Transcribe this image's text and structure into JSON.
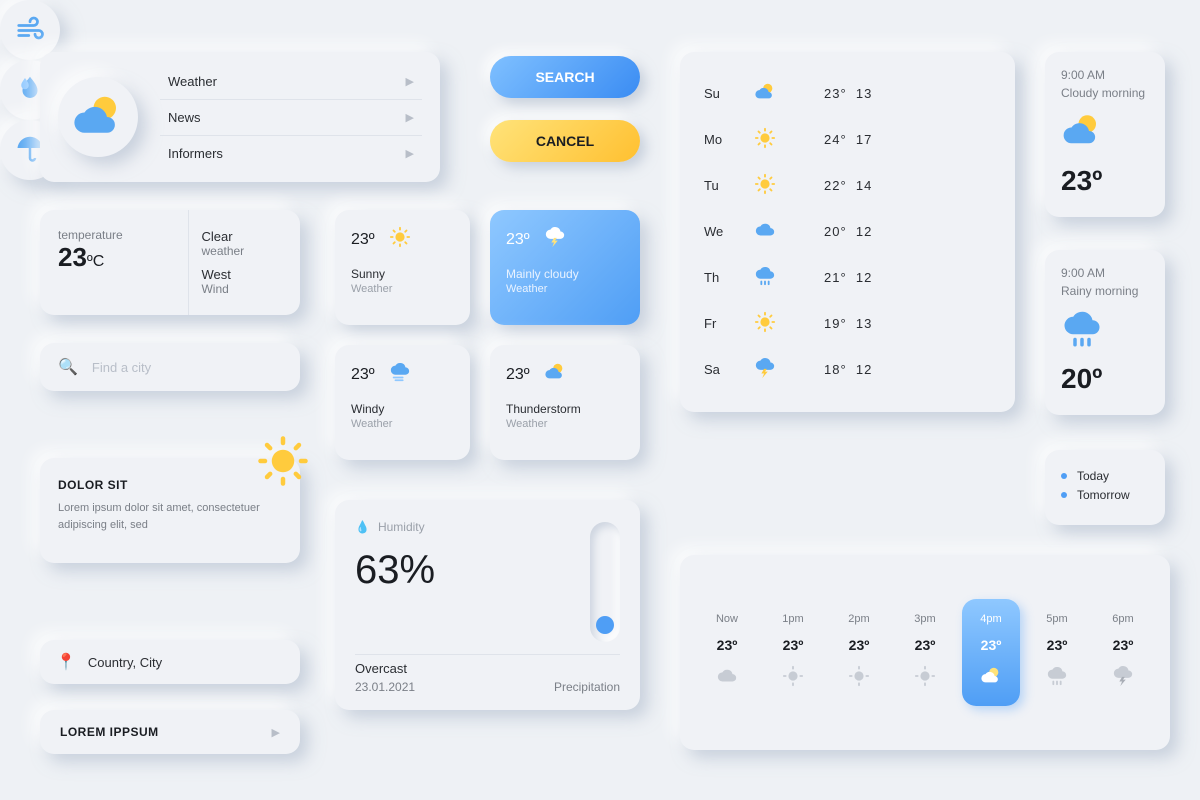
{
  "menu": {
    "items": [
      "Weather",
      "News",
      "Informers"
    ]
  },
  "buttons": {
    "search": "SEARCH",
    "cancel": "CANCEL",
    "lorem": "LOREM IPPSUM"
  },
  "weekly": [
    {
      "day": "Su",
      "icon": "partly-cloudy",
      "hi": "23°",
      "lo": "13"
    },
    {
      "day": "Mo",
      "icon": "sun",
      "hi": "24°",
      "lo": "17"
    },
    {
      "day": "Tu",
      "icon": "sun",
      "hi": "22°",
      "lo": "14"
    },
    {
      "day": "We",
      "icon": "cloud",
      "hi": "20°",
      "lo": "12"
    },
    {
      "day": "Th",
      "icon": "rain",
      "hi": "21°",
      "lo": "12"
    },
    {
      "day": "Fr",
      "icon": "sun",
      "hi": "19°",
      "lo": "13"
    },
    {
      "day": "Sa",
      "icon": "storm",
      "hi": "18°",
      "lo": "12"
    }
  ],
  "tempCard": {
    "label": "temperature",
    "value": "23",
    "unit": "ºC",
    "cond1a": "Clear",
    "cond1b": "weather",
    "cond2a": "West",
    "cond2b": "Wind"
  },
  "search": {
    "placeholder": "Find a city"
  },
  "minis": {
    "sunny": {
      "temp": "23º",
      "l1": "Sunny",
      "l2": "Weather"
    },
    "cloudy": {
      "temp": "23º",
      "l1": "Mainly cloudy",
      "l2": "Weather"
    },
    "windy": {
      "temp": "23º",
      "l1": "Windy",
      "l2": "Weather"
    },
    "thunder": {
      "temp": "23º",
      "l1": "Thunderstorm",
      "l2": "Weather"
    }
  },
  "dolor": {
    "title": "DOLOR SIT",
    "body": "Lorem ipsum dolor sit amet, consectetuer adipiscing elit, sed"
  },
  "location": "Country, City",
  "humidity": {
    "label": "Humidity",
    "value": "63%",
    "bottomLeft1": "Overcast",
    "bottomLeft2": "23.01.2021",
    "bottomRight": "Precipitation"
  },
  "detailCards": {
    "cloudy": {
      "time": "9:00 AM",
      "desc": "Cloudy morning",
      "temp": "23º"
    },
    "rainy": {
      "time": "9:00 AM",
      "desc": "Rainy morning",
      "temp": "20º"
    }
  },
  "tabs": [
    "Today",
    "Tomorrow"
  ],
  "hourly": [
    {
      "t": "Now",
      "temp": "23º",
      "icon": "cloud"
    },
    {
      "t": "1pm",
      "temp": "23º",
      "icon": "sun-grey"
    },
    {
      "t": "2pm",
      "temp": "23º",
      "icon": "sun-grey"
    },
    {
      "t": "3pm",
      "temp": "23º",
      "icon": "sun-grey"
    },
    {
      "t": "4pm",
      "temp": "23º",
      "icon": "partly-cloudy",
      "selected": true
    },
    {
      "t": "5pm",
      "temp": "23º",
      "icon": "rain-grey"
    },
    {
      "t": "6pm",
      "temp": "23º",
      "icon": "storm-grey"
    }
  ],
  "colors": {
    "blue": "#4f9ef5",
    "yellow": "#ffc030"
  }
}
